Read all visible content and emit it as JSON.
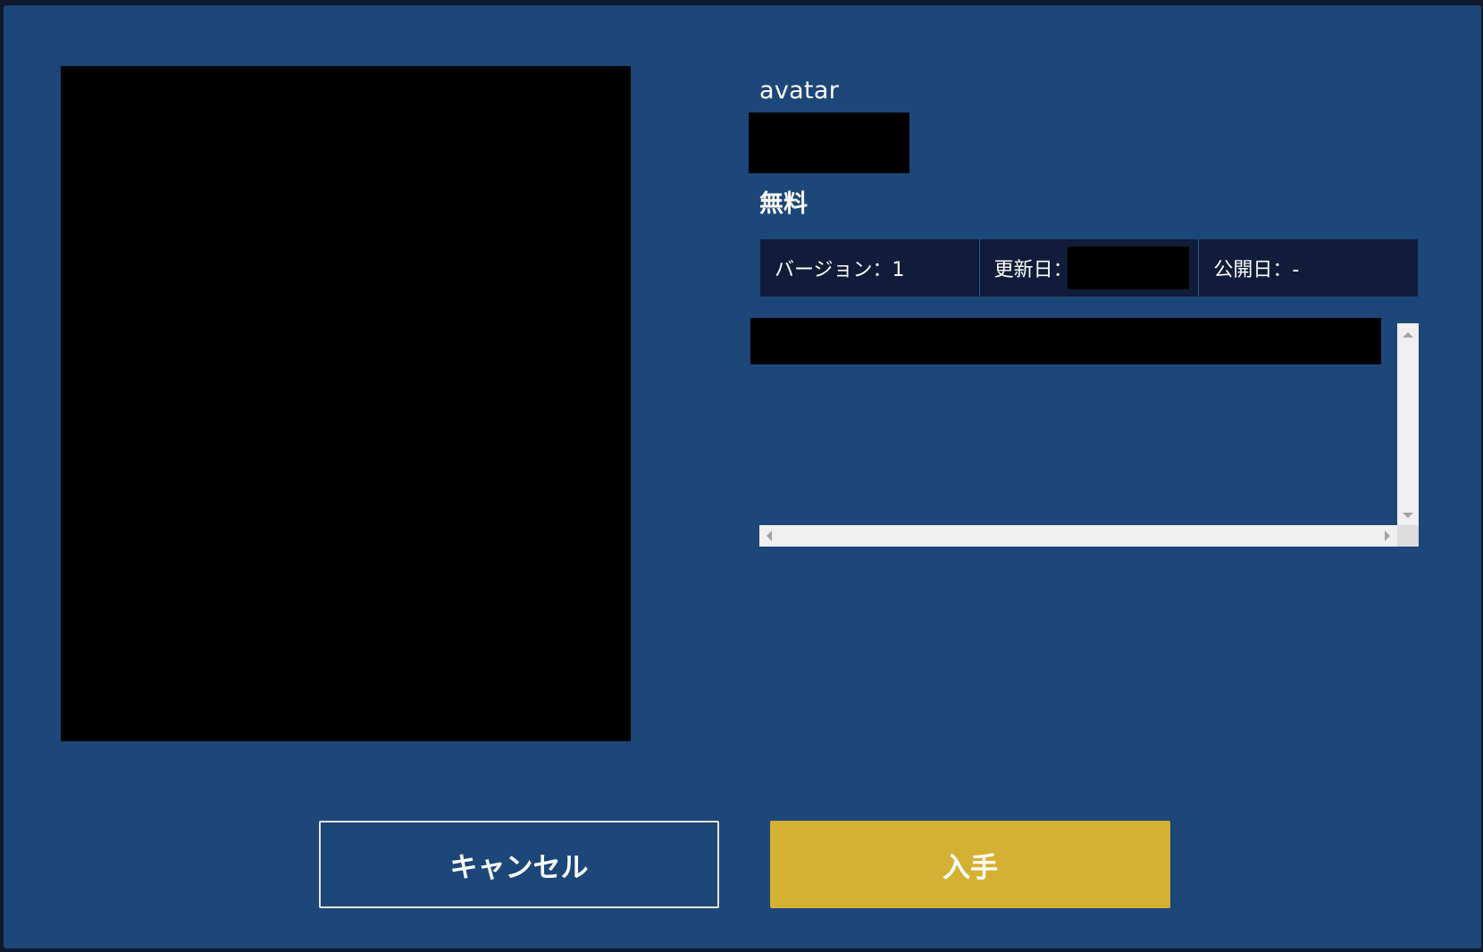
{
  "item": {
    "category": "avatar",
    "price": "無料"
  },
  "meta": {
    "version_label": "バージョン：1",
    "updated_label": "更新日：",
    "published_label": "公開日：-"
  },
  "actions": {
    "cancel_label": "キャンセル",
    "get_label": "入手"
  },
  "colors": {
    "dialog_bg": "#1d4679",
    "meta_bg": "#101c39",
    "primary_button": "#d4b133"
  }
}
